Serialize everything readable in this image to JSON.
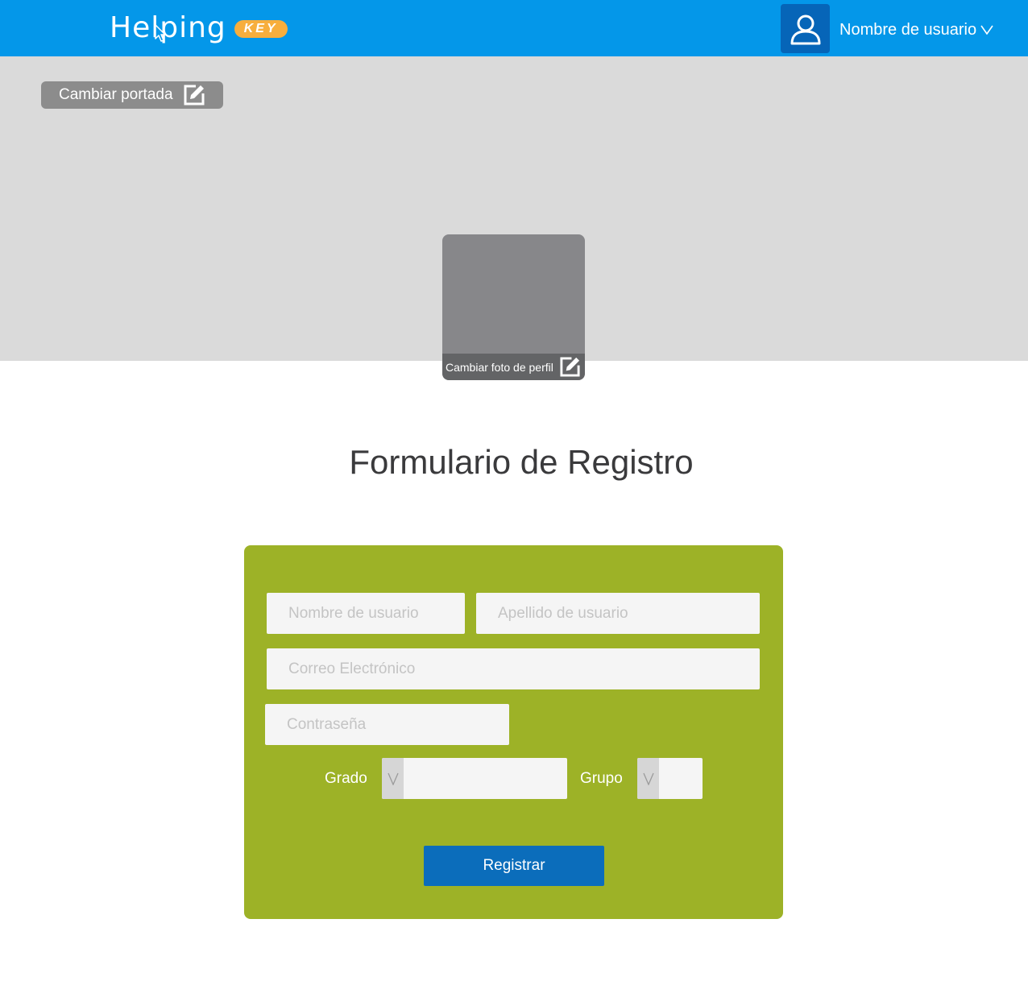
{
  "header": {
    "logo_text": "Helping",
    "logo_badge": "KEY",
    "user_name": "Nombre de usuario",
    "color": "#0497e9"
  },
  "cover": {
    "change_cover_label": "Cambiar portada",
    "change_profile_photo_label": "Cambiar foto de perfil"
  },
  "form": {
    "title": "Formulario de Registro",
    "placeholders": {
      "first_name": "Nombre de usuario",
      "last_name": "Apellido de usuario",
      "email": "Correo Electrónico",
      "password": "Contraseña"
    },
    "grade_label": "Grado",
    "group_label": "Grupo",
    "submit_label": "Registrar",
    "panel_color": "#9db227"
  },
  "icons": {
    "user": "user-icon",
    "chevron": "chevron-down-icon",
    "edit": "edit-icon",
    "cursor": "cursor-icon"
  }
}
